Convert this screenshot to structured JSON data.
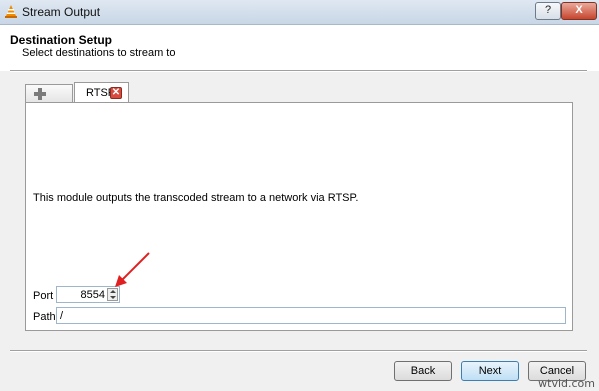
{
  "window": {
    "title": "Stream Output",
    "help_label": "?",
    "close_label": "X"
  },
  "header": {
    "title": "Destination Setup",
    "subtitle": "Select destinations to stream to"
  },
  "tabs": {
    "add_icon": "plus-icon",
    "active_label": "RTSP",
    "close_icon": "close-icon",
    "close_glyph": "✕"
  },
  "panel": {
    "description": "This module outputs the transcoded stream to a network via RTSP.",
    "port_label": "Port",
    "port_value": "8554",
    "path_label": "Path",
    "path_value": "/"
  },
  "buttons": {
    "back": "Back",
    "next": "Next",
    "cancel": "Cancel"
  },
  "annotation": {
    "arrow_color": "#e02020"
  },
  "watermark": "wtvid.com"
}
